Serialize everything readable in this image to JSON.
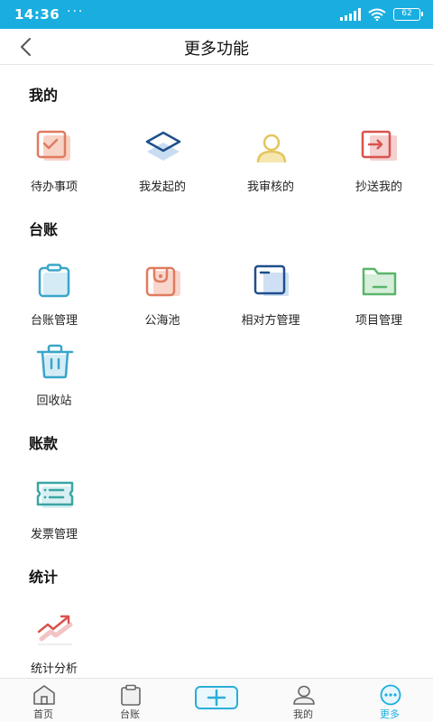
{
  "status_bar": {
    "time": "14:36",
    "dots": "···",
    "battery": "62"
  },
  "header": {
    "title": "更多功能"
  },
  "sections": [
    {
      "title": "我的",
      "items": [
        {
          "label": "待办事项",
          "icon": "calendar-check-icon"
        },
        {
          "label": "我发起的",
          "icon": "layers-icon"
        },
        {
          "label": "我审核的",
          "icon": "user-icon"
        },
        {
          "label": "抄送我的",
          "icon": "forward-icon"
        }
      ]
    },
    {
      "title": "台账",
      "items": [
        {
          "label": "台账管理",
          "icon": "clipboard-icon"
        },
        {
          "label": "公海池",
          "icon": "bag-icon"
        },
        {
          "label": "相对方管理",
          "icon": "window-icon"
        },
        {
          "label": "项目管理",
          "icon": "folder-icon"
        },
        {
          "label": "回收站",
          "icon": "trash-icon"
        }
      ]
    },
    {
      "title": "账款",
      "items": [
        {
          "label": "发票管理",
          "icon": "ticket-icon"
        }
      ]
    },
    {
      "title": "统计",
      "items": [
        {
          "label": "统计分析",
          "icon": "trend-icon"
        }
      ]
    }
  ],
  "tab_bar": {
    "items": [
      {
        "label": "首页",
        "icon": "home-icon"
      },
      {
        "label": "台账",
        "icon": "clipboard-icon"
      },
      {
        "label": "",
        "icon": "plus-icon"
      },
      {
        "label": "我的",
        "icon": "user-icon"
      },
      {
        "label": "更多",
        "icon": "more-icon",
        "active": true
      }
    ]
  },
  "colors": {
    "status_bar": "#1aaee0",
    "accent": "#1aaee0",
    "orange": "#e07b5f",
    "navy": "#1e4f8a",
    "yellow": "#e6c45a",
    "red": "#d9534f",
    "teal": "#3aa6c9",
    "green": "#5bb56a"
  }
}
